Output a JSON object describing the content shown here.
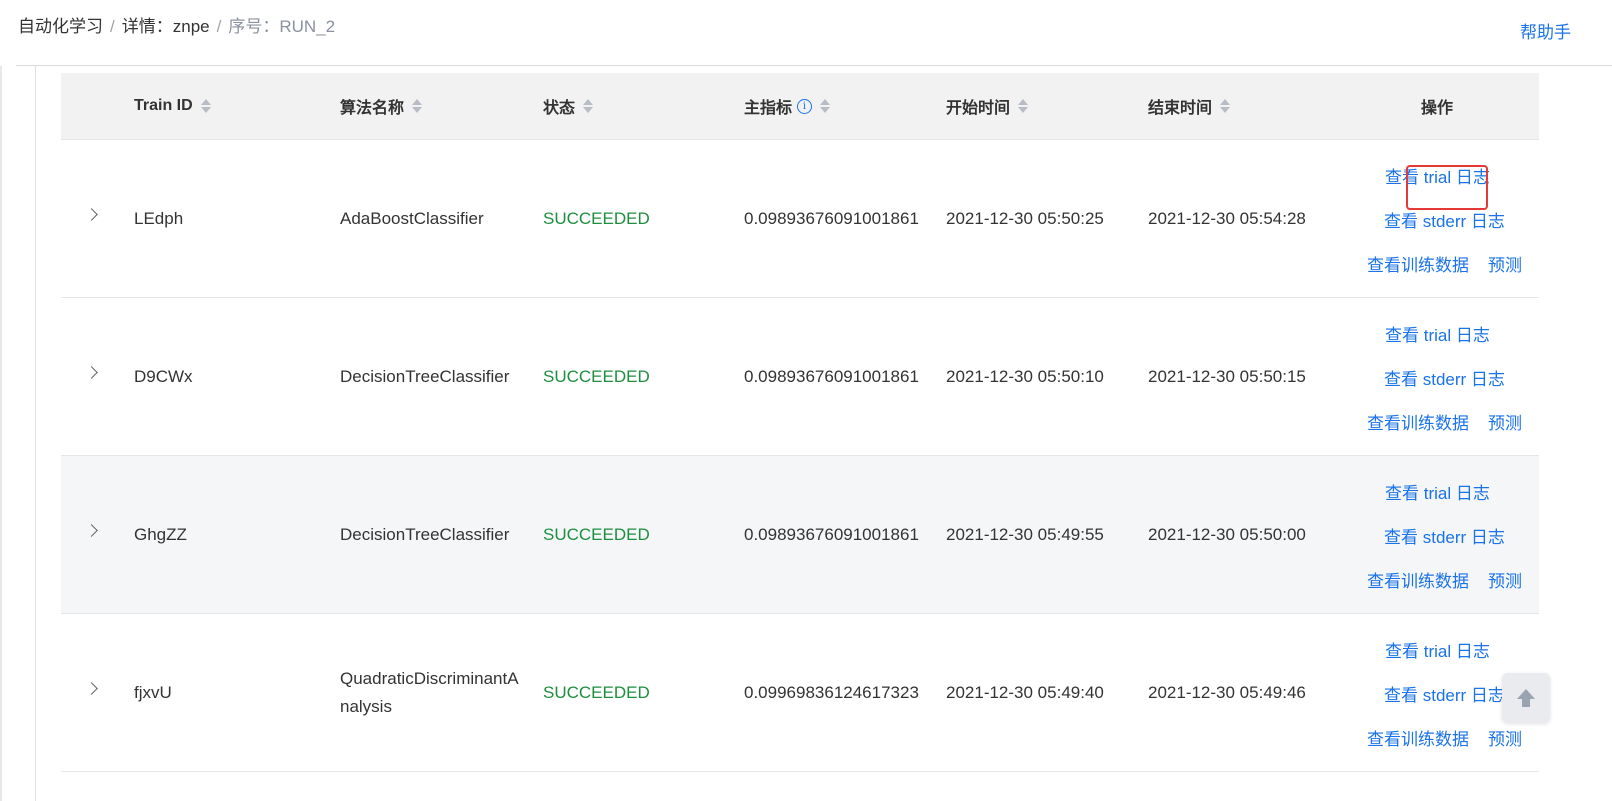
{
  "breadcrumb": [
    {
      "label": "自动化学习"
    },
    {
      "label": "详情：znpe"
    },
    {
      "label": "序号：RUN_2"
    }
  ],
  "breadcrumb_separator": "/",
  "help_link": "帮助手",
  "table": {
    "columns": {
      "train_id": "Train ID",
      "algorithm": "算法名称",
      "status": "状态",
      "metric": "主指标",
      "start_time": "开始时间",
      "end_time": "结束时间",
      "actions": "操作"
    },
    "metric_info_icon": "info-icon",
    "rows": [
      {
        "train_id": "LEdph",
        "algorithm": "AdaBoostClassifier",
        "status": "SUCCEEDED",
        "metric": "0.09893676091001861",
        "start_time": "2021-12-30 05:50:25",
        "end_time": "2021-12-30 05:54:28"
      },
      {
        "train_id": "D9CWx",
        "algorithm": "DecisionTreeClassifier",
        "status": "SUCCEEDED",
        "metric": "0.09893676091001861",
        "start_time": "2021-12-30 05:50:10",
        "end_time": "2021-12-30 05:50:15"
      },
      {
        "train_id": "GhgZZ",
        "algorithm": "DecisionTreeClassifier",
        "status": "SUCCEEDED",
        "metric": "0.09893676091001861",
        "start_time": "2021-12-30 05:49:55",
        "end_time": "2021-12-30 05:50:00"
      },
      {
        "train_id": "fjxvU",
        "algorithm": "QuadraticDiscriminantAnalysis",
        "status": "SUCCEEDED",
        "metric": "0.09969836124617323",
        "start_time": "2021-12-30 05:49:40",
        "end_time": "2021-12-30 05:49:46"
      }
    ],
    "actions": {
      "trial_log": "查看 trial 日志",
      "stderr_log": "查看 stderr 日志",
      "train_data": "查看训练数据",
      "predict": "预测"
    }
  },
  "colors": {
    "link": "#1a73e8",
    "success": "#1e8e3e",
    "highlight": "#e53935",
    "header_bg": "#f2f2f2"
  },
  "scroll_top_icon": "arrow-up-icon"
}
